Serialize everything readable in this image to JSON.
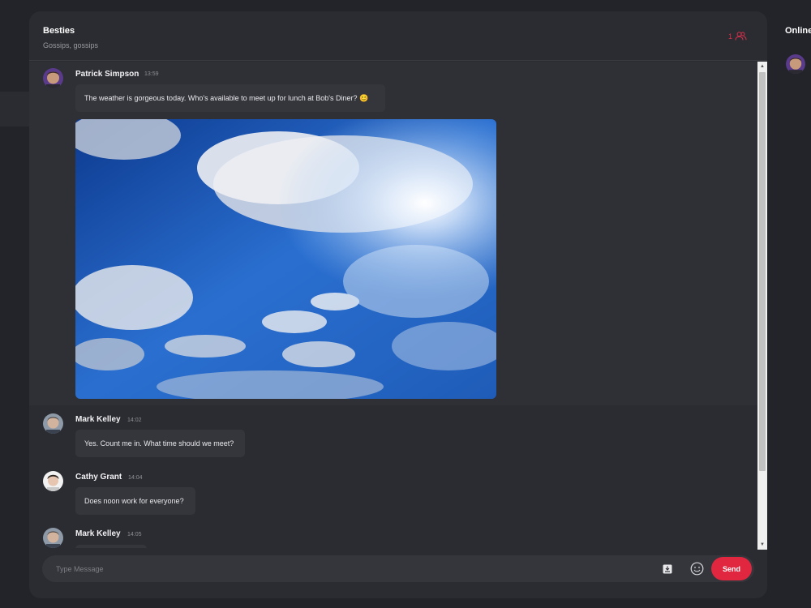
{
  "chat": {
    "title": "Besties",
    "subtitle": "Gossips, gossips",
    "member_count": "1",
    "member_icon": "users-icon"
  },
  "messages": [
    {
      "author": "Patrick Simpson",
      "time": "13:59",
      "text": "The weather is gorgeous today. Who's available to meet up for lunch at Bob's Diner? 😊",
      "attachment": "sky-photo"
    },
    {
      "author": "Mark Kelley",
      "time": "14:02",
      "text": "Yes. Count me in. What time should we meet?"
    },
    {
      "author": "Cathy Grant",
      "time": "14:04",
      "text": "Does noon work for everyone?"
    },
    {
      "author": "Mark Kelley",
      "time": "14:05",
      "text": ""
    }
  ],
  "composer": {
    "placeholder": "Type Message",
    "value": "",
    "attach_icon": "attachment-icon",
    "emoji_icon": "emoji-icon",
    "send_label": "Send"
  },
  "online": {
    "title": "Online"
  },
  "colors": {
    "accent": "#e0273f",
    "background": "#232429",
    "panel": "#2b2c31",
    "bubble": "#35363c"
  }
}
